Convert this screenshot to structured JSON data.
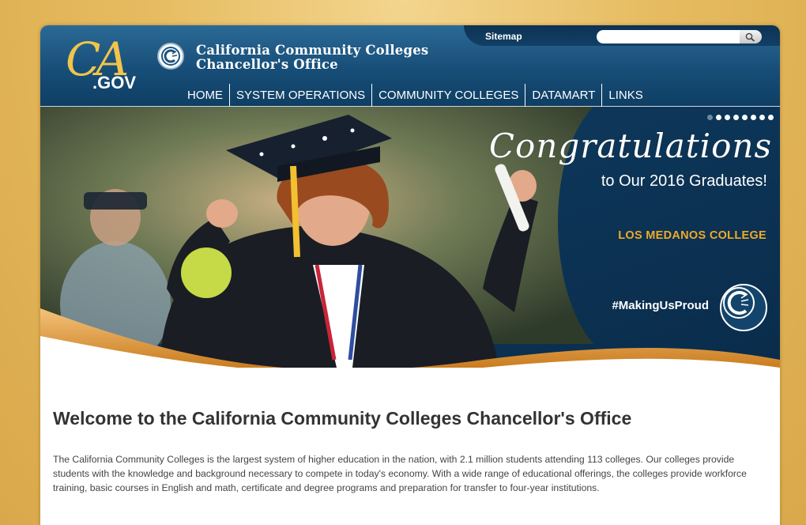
{
  "header": {
    "logo_ca": "CA",
    "logo_gov": ".GOV",
    "org_line1": "California Community Colleges",
    "org_line2": "Chancellor's Office",
    "sitemap_label": "Sitemap",
    "search": {
      "placeholder": "",
      "value": ""
    }
  },
  "nav": {
    "items": [
      {
        "label": "HOME"
      },
      {
        "label": "SYSTEM OPERATIONS"
      },
      {
        "label": "COMMUNITY COLLEGES"
      },
      {
        "label": "DATAMART"
      },
      {
        "label": "LINKS"
      }
    ]
  },
  "banner": {
    "headline": "Congratulations",
    "subline": "to Our 2016 Graduates!",
    "college": "LOS MEDANOS COLLEGE",
    "hashtag": "#MakingUsProud",
    "slide_count": 8,
    "active_slide": 1
  },
  "colors": {
    "header_blue": "#174e78",
    "gold_accent": "#e8a33c",
    "college_gold": "#eeaa2a",
    "background_gold": "#e6bb60"
  },
  "content": {
    "title": "Welcome to the California Community Colleges Chancellor's Office",
    "intro": "The California Community Colleges is the largest system of higher education in the nation, with 2.1 million students attending 113 colleges. Our colleges provide students with the knowledge and background necessary to compete in today's economy. With a wide range of educational offerings, the colleges provide workforce training, basic courses in English and math, certificate and degree programs and preparation for transfer to four-year institutions."
  }
}
